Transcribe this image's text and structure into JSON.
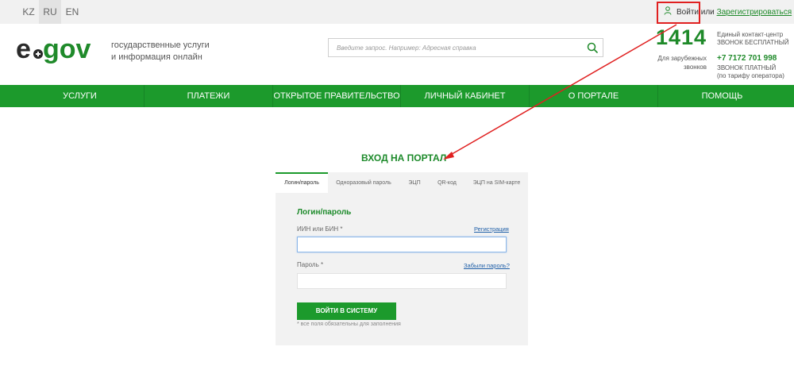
{
  "languages": [
    "KZ",
    "RU",
    "EN"
  ],
  "top_login": {
    "login": "Войти",
    "or": "или",
    "register": "Зарегистрироваться"
  },
  "brand": {
    "logo_text": "egov",
    "tagline_line1": "государственные услуги",
    "tagline_line2": "и информация онлайн"
  },
  "search": {
    "placeholder": "Введите запрос. Например: Адресная справка"
  },
  "contacts": {
    "short_number": "1414",
    "abroad_line1": "Для зарубежных",
    "abroad_line2": "звонков",
    "center_line1": "Единый контакт-центр",
    "center_line2": "ЗВОНОК БЕСПЛАТНЫЙ",
    "phone": "+7 7172 701 998",
    "paid_line1": "ЗВОНОК ПЛАТНЫЙ",
    "paid_line2": "(по тарифу оператора)"
  },
  "nav": [
    "УСЛУГИ",
    "ПЛАТЕЖИ",
    "ОТКРЫТОЕ ПРАВИТЕЛЬСТВО",
    "ЛИЧНЫЙ КАБИНЕТ",
    "О ПОРТАЛЕ",
    "ПОМОЩЬ"
  ],
  "page_title": "ВХОД НА ПОРТАЛ",
  "tabs": [
    "Логин/пароль",
    "Одноразовый пароль",
    "ЭЦП",
    "QR-код",
    "ЭЦП на SIM-карте"
  ],
  "form": {
    "title": "Логин/пароль",
    "iin_label": "ИИН или БИН *",
    "register_link": "Регистрация",
    "iin_value": "",
    "password_label": "Пароль *",
    "forgot_link": "Забыли пароль?",
    "password_value": "",
    "submit": "ВОЙТИ В СИСТЕМУ",
    "note": "* все поля обязательны для заполнения"
  },
  "colors": {
    "brand_green": "#1c9a2c",
    "annotation_red": "#e02020",
    "link_blue": "#1f5fa8"
  }
}
